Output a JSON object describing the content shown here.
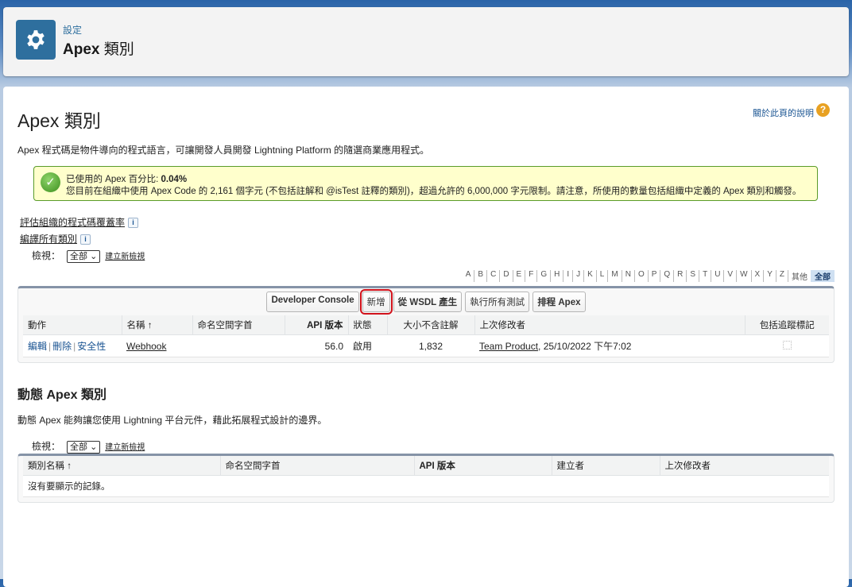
{
  "header": {
    "breadcrumb": "設定",
    "title_bold": "Apex",
    "title_rest": "類別"
  },
  "page": {
    "title": "Apex 類別",
    "help_link": "關於此頁的說明",
    "help_icon": "?",
    "description": "Apex 程式碼是物件導向的程式語言，可讓開發人員開發 Lightning Platform 的隨選商業應用程式。"
  },
  "message": {
    "line1_label": "已使用的 Apex 百分比:",
    "line1_value": "0.04%",
    "line2": "您目前在組織中使用 Apex Code 的 2,161 個字元 (不包括註解和 @isTest 註釋的類別)，超過允許的 6,000,000 字元限制。請注意，所使用的數量包括組織中定義的 Apex 類別和觸發。"
  },
  "links": {
    "coverage": "評估組織的程式碼覆蓋率",
    "compile": "編譯所有類別",
    "info": "i"
  },
  "view": {
    "label": "檢視：",
    "selected": "全部",
    "create": "建立新檢視"
  },
  "alphabet": [
    "A",
    "B",
    "C",
    "D",
    "E",
    "F",
    "G",
    "H",
    "I",
    "J",
    "K",
    "L",
    "M",
    "N",
    "O",
    "P",
    "Q",
    "R",
    "S",
    "T",
    "U",
    "V",
    "W",
    "X",
    "Y",
    "Z",
    "其他",
    "全部"
  ],
  "buttons": {
    "dev_console": "Developer Console",
    "new": "新增",
    "wsdl": "從 WSDL 產生",
    "run_tests": "執行所有測試",
    "schedule": "排程 Apex"
  },
  "classes_table": {
    "columns": [
      "動作",
      "名稱 ↑",
      "命名空間字首",
      "API 版本",
      "狀態",
      "大小不含註解",
      "上次修改者",
      "包括追蹤標記"
    ],
    "rows": [
      {
        "edit": "編輯",
        "delete": "刪除",
        "security": "安全性",
        "name": "Webhook",
        "namespace": "",
        "api": "56.0",
        "status": "啟用",
        "size": "1,832",
        "modified_by": "Team Product",
        "modified_at": ", 25/10/2022 下午7:02"
      }
    ]
  },
  "dynamic": {
    "title": "動態 Apex 類別",
    "description": "動態 Apex 能夠讓您使用 Lightning 平台元件，藉此拓展程式設計的邊界。",
    "columns": [
      "類別名稱 ↑",
      "命名空間字首",
      "API 版本",
      "建立者",
      "上次修改者"
    ],
    "empty": "沒有要顯示的記錄。"
  }
}
